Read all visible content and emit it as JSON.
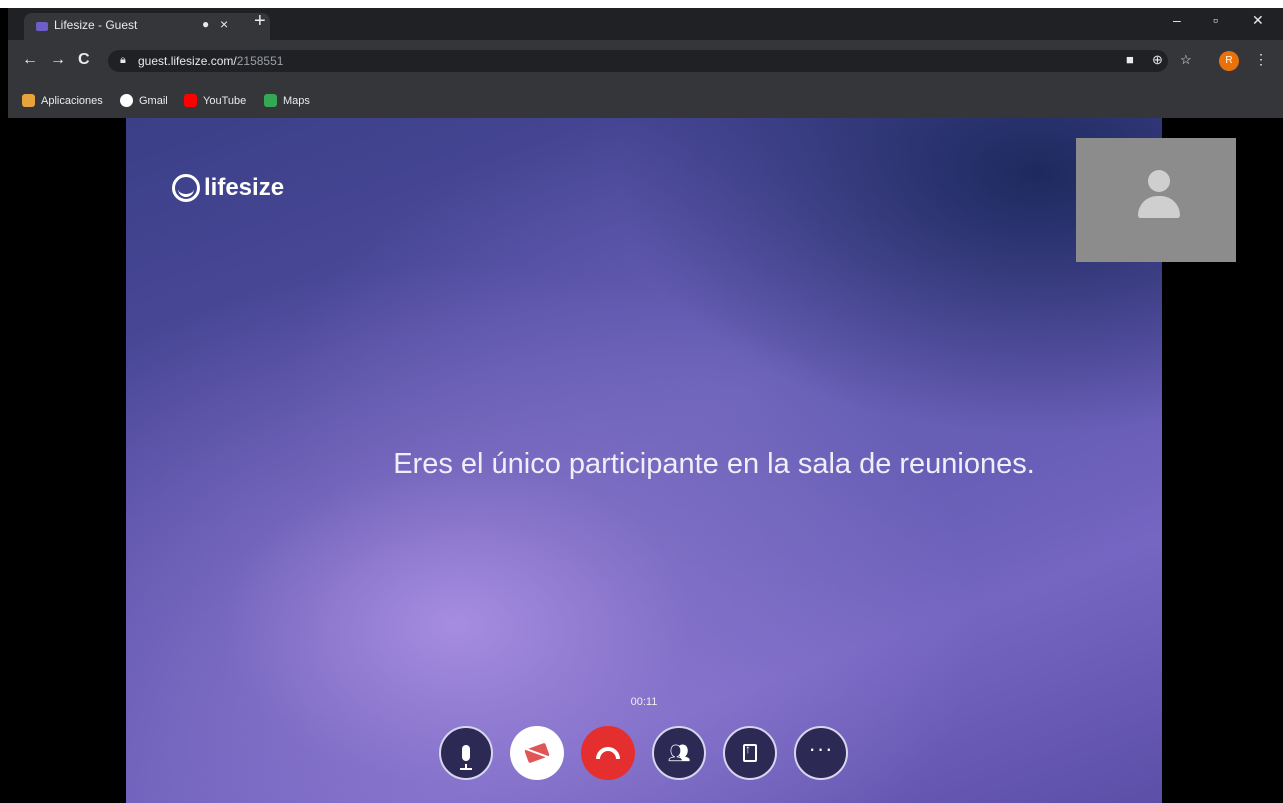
{
  "browser": {
    "tab_title": "Lifesize - Guest",
    "tab_audio_icon": "speaker-icon",
    "tab_close": "×",
    "new_tab": "+",
    "window_minimize": "–",
    "window_restore": "▫",
    "window_close": "✕",
    "nav": {
      "back": "←",
      "forward": "→",
      "reload": "C"
    },
    "url_host": "guest.lifesize.com/",
    "url_path": "2158551",
    "profile_initial": "R",
    "menu": "⋮"
  },
  "bookmarks": [
    {
      "label": "Aplicaciones",
      "icon": "apps-grid-icon",
      "color": "#e8a33d"
    },
    {
      "label": "Gmail",
      "icon": "gmail-icon",
      "color": "#ffffff"
    },
    {
      "label": "YouTube",
      "icon": "youtube-icon",
      "color": "#ff0000"
    },
    {
      "label": "Maps",
      "icon": "maps-icon",
      "color": "#34a853"
    }
  ],
  "call": {
    "brand": "lifesize",
    "message": "Eres el único participante en la sala de reuniones.",
    "timer": "00:11",
    "self_view_icon": "user-silhouette-icon",
    "controls": [
      {
        "name": "mic-button",
        "icon": "microphone-icon",
        "state": "on"
      },
      {
        "name": "camera-button",
        "icon": "camera-off-icon",
        "state": "off"
      },
      {
        "name": "hangup-button",
        "icon": "phone-hangup-icon",
        "color": "#e52f2f"
      },
      {
        "name": "participants-button",
        "icon": "people-icon"
      },
      {
        "name": "share-button",
        "icon": "share-screen-icon"
      },
      {
        "name": "more-button",
        "icon": "more-dots-icon",
        "label": "···"
      }
    ]
  }
}
